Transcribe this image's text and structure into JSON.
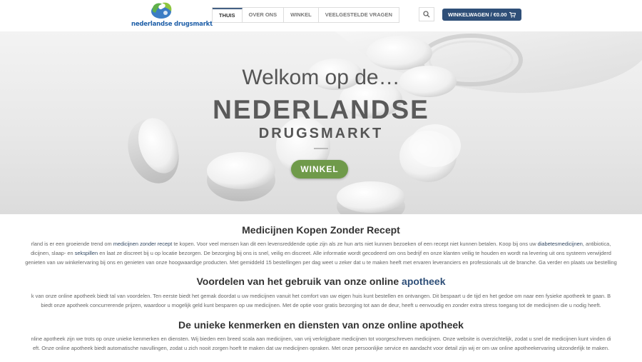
{
  "header": {
    "logo_text": "nederlandse drugsmarkt",
    "nav": [
      "THUIS",
      "OVER ONS",
      "WINKEL",
      "VEELGESTELDE VRAGEN"
    ],
    "cart_label": "WINKELWAGEN / €0.00"
  },
  "hero": {
    "subtitle": "Welkom op de…",
    "title": "NEDERLANDSE",
    "tagline": "DRUGSMARKT",
    "button": "WINKEL"
  },
  "section1": {
    "heading": "Medicijnen Kopen Zonder Recept",
    "line1_a": "rland is er een groeiende trend om ",
    "line1_link": "medicijnen zonder recept",
    "line1_b": " te kopen. Voor veel mensen kan dit een levensreddende optie zijn als ze hun arts niet kunnen bezoeken of een recept niet kunnen betalen. Koop bij ons uw ",
    "line1_link2": "diabetesmedicijnen",
    "line1_c": ", antibiotica,",
    "line2_a": "dicijnen, slaap- en ",
    "line2_link": "sekspillen",
    "line2_b": " en laat ze discreet bij u op locatie bezorgen. De bezorging bij ons is snel, veilig en discreet. Alle informatie wordt gecodeerd om ons bedrijf en onze klanten veilig te houden en wordt na levering uit ons systeem verwijderd",
    "line3": "genieten van uw winkelervaring bij ons en genieten van onze hoogwaardige producten. Met gemiddeld 15 bestellingen per dag weet u zeker dat u te maken heeft met ervaren leveranciers en professionals uit de branche. Ga verder en plaats uw bestelling"
  },
  "section2": {
    "heading_a": "Voordelen van het gebruik van onze online ",
    "heading_b": "apotheek",
    "line1": "k van onze online apotheek biedt tal van voordelen. Ten eerste biedt het gemak doordat u uw medicijnen vanuit het comfort van uw eigen huis kunt bestellen en ontvangen. Dit bespaart u de tijd en het gedoe om naar een fysieke apotheek te gaan. B",
    "line2": "biedt onze apotheek concurrerende prijzen, waardoor u mogelijk geld kunt besparen op uw medicijnen. Met de optie voor gratis bezorging tot aan de deur, heeft u eenvoudig en zonder extra stress toegang tot de medicijnen die u nodig heeft."
  },
  "section3": {
    "heading": "De unieke kenmerken en diensten van onze online apotheek",
    "line1": "nline apotheek zijn we trots op onze unieke kenmerken en diensten. Wij bieden een breed scala aan medicijnen, van vrij verkrijgbare medicijnen tot voorgeschreven medicijnen. Onze website is overzichtelijk, zodat u snel de medicijnen kunt vinden di",
    "line2": "eft. Onze online apotheek biedt automatische navullingen, zodat u zich nooit zorgen hoeft te maken dat uw medicijnen opraken. Met onze persoonlijke service en aandacht voor detail zijn wij er om uw online apotheekervaring uitzonderlijk te maken."
  },
  "colors": {
    "brand_blue": "#2f4f78",
    "button_green": "#6f9a4a",
    "link": "#334862"
  },
  "icons": {
    "search": "search-icon",
    "cart": "cart-icon",
    "logo": "pill-logo-icon"
  }
}
